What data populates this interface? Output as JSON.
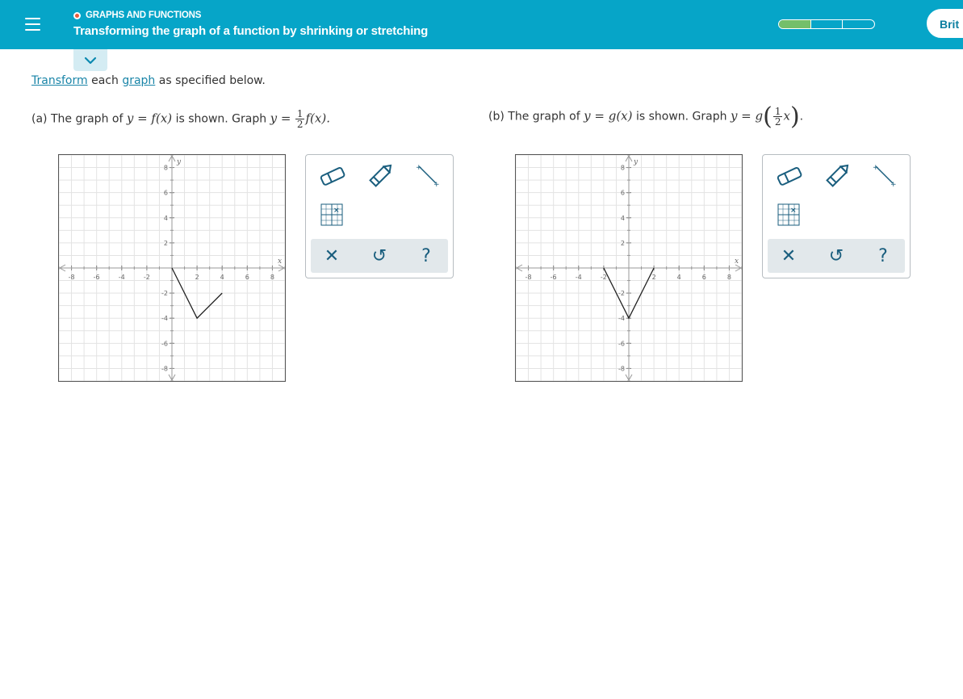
{
  "header": {
    "topic": "GRAPHS AND FUNCTIONS",
    "lesson_title": "Transforming the graph of a function by shrinking or stretching",
    "progress": {
      "segments": 3,
      "filled": 1
    },
    "brand_button": "Brit",
    "colors": {
      "bar": "#06a5c8",
      "progress_fill": "#74bf6a",
      "status_dot": "#e85b3a"
    }
  },
  "instructions": {
    "link1": "Transform",
    "text1": " each ",
    "link2": "graph",
    "text2": " as specified below."
  },
  "parts": [
    {
      "label": "(a)",
      "prefix": "The graph of ",
      "given": "y = f(x)",
      "middle": " is shown. Graph ",
      "target_lhs": "y =",
      "frac_num": "1",
      "frac_den": "2",
      "target_rhs": "f(x).",
      "graph": {
        "xlim": [
          -9,
          9
        ],
        "ylim": [
          -9,
          9
        ],
        "tick_values": [
          -8,
          -6,
          -4,
          -2,
          2,
          4,
          6,
          8
        ],
        "x_axis_label": "x",
        "y_axis_label": "y",
        "polyline": [
          [
            0,
            0
          ],
          [
            2,
            -4
          ],
          [
            4,
            -2
          ]
        ]
      }
    },
    {
      "label": "(b)",
      "prefix": "The graph of ",
      "given": "y = g(x)",
      "middle": " is shown. Graph ",
      "target_lhs": "y = g",
      "frac_num": "1",
      "frac_den": "2",
      "target_rhs": "x",
      "trailing": ".",
      "graph": {
        "xlim": [
          -9,
          9
        ],
        "ylim": [
          -9,
          9
        ],
        "tick_values": [
          -8,
          -6,
          -4,
          -2,
          2,
          4,
          6,
          8
        ],
        "x_axis_label": "x",
        "y_axis_label": "y",
        "polyline": [
          [
            -2,
            0
          ],
          [
            0,
            -4
          ],
          [
            2,
            0
          ]
        ]
      }
    }
  ],
  "toolbox": {
    "tools": [
      "eraser-icon",
      "pencil-icon",
      "line-segment-icon",
      "point-grid-icon"
    ],
    "actions": [
      {
        "name": "clear",
        "glyph": "✕"
      },
      {
        "name": "undo",
        "glyph": "↺"
      },
      {
        "name": "help",
        "glyph": "?"
      }
    ]
  }
}
